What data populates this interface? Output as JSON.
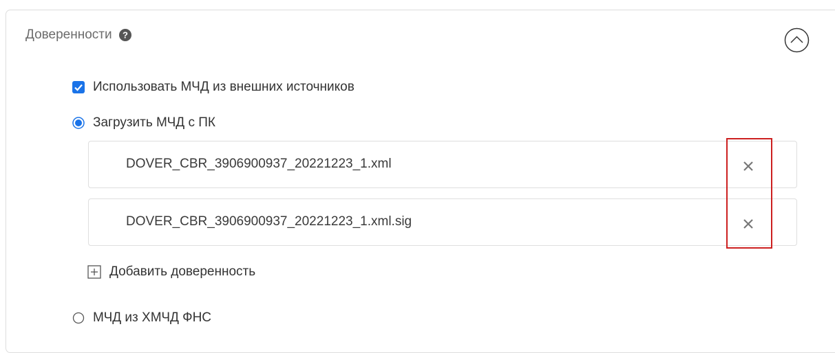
{
  "section": {
    "title": "Доверенности",
    "help_icon": "question-circle-icon",
    "collapse_icon": "chevron-up-circle-icon"
  },
  "options": {
    "use_external": {
      "label": "Использовать МЧД из внешних источников",
      "checked": true
    },
    "upload_from_pc": {
      "label": "Загрузить МЧД с ПК",
      "selected": true
    },
    "from_fns": {
      "label": "МЧД из ХМЧД ФНС",
      "selected": false
    }
  },
  "files": [
    {
      "name": "DOVER_CBR_3906900937_20221223_1.xml",
      "remove_icon": "close-icon"
    },
    {
      "name": "DOVER_CBR_3906900937_20221223_1.xml.sig",
      "remove_icon": "close-icon"
    }
  ],
  "add_button": {
    "label": "Добавить доверенность",
    "icon": "plus-square-icon"
  },
  "colors": {
    "accent": "#1a73e8",
    "highlight": "#cc1f1f",
    "border": "#dddddd"
  }
}
